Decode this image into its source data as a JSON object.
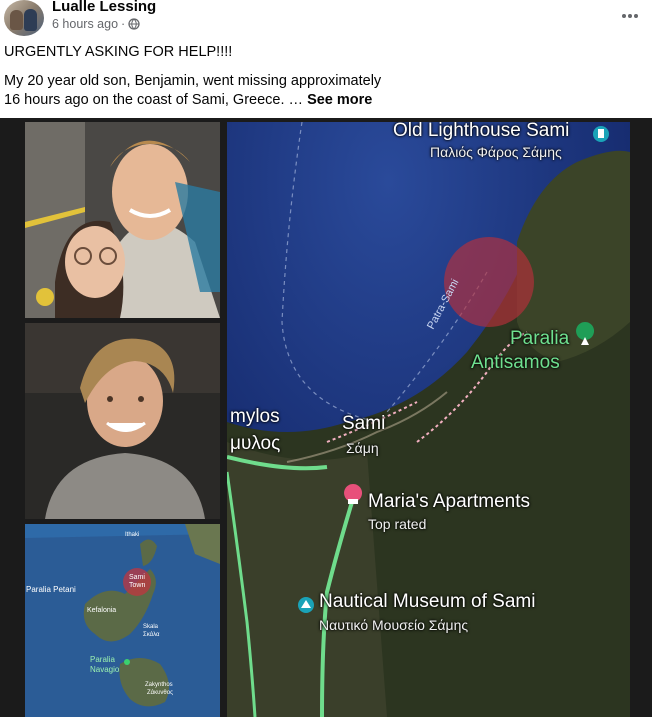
{
  "post": {
    "author": "Lualle Lessing",
    "time": "6 hours ago",
    "separator": "·",
    "line1": "URGENTLY ASKING FOR HELP!!!!",
    "line2": "My 20 year old son, Benjamin, went missing approximately",
    "line3": "16 hours ago on the coast of Sami, Greece. …",
    "see_more": "See more"
  },
  "icons": {
    "globe": "globe-icon",
    "more": "more-options-icon",
    "pin_lodging": "hotel-pin-icon",
    "pin_museum": "museum-pin-icon",
    "pin_lighthouse": "lighthouse-pin-icon",
    "pin_park": "park-pin-icon"
  },
  "map": {
    "lighthouse": "Old Lighthouse Sami",
    "lighthouse_gr": "Παλιός Φάρος Σάμης",
    "ferry": "Patra-Sami",
    "beach": "Paralia",
    "beach2": "Antisamos",
    "mylos": "mylos",
    "mylos_gr": "μυλος",
    "town": "Sami",
    "town_gr": "Σάμη",
    "apartments": "Maria's Apartments",
    "apartments_sub": "Top rated",
    "museum": "Nautical Museum of Sami",
    "museum_gr": "Ναυτικό Μουσείο Σάμης"
  },
  "inset_map": {
    "ithaki": "Ithaki",
    "sami": "Sami",
    "sami2": "Town",
    "petani": "Paralia Petani",
    "kefalonia": "Kefalonia",
    "skala": "Skala",
    "skala_gr": "Σκάλα",
    "navagio1": "Paralia",
    "navagio2": "Navagio",
    "zakynthos": "Zakynthos",
    "zakynthos_gr": "Ζάκυνθος"
  },
  "colors": {
    "sea": "#1e3a7a",
    "land": "#2f3a22",
    "road": "#5fcf7a",
    "circle": "#c0353f",
    "pin": "#e8507a",
    "teal_pin": "#1aa3b8"
  }
}
